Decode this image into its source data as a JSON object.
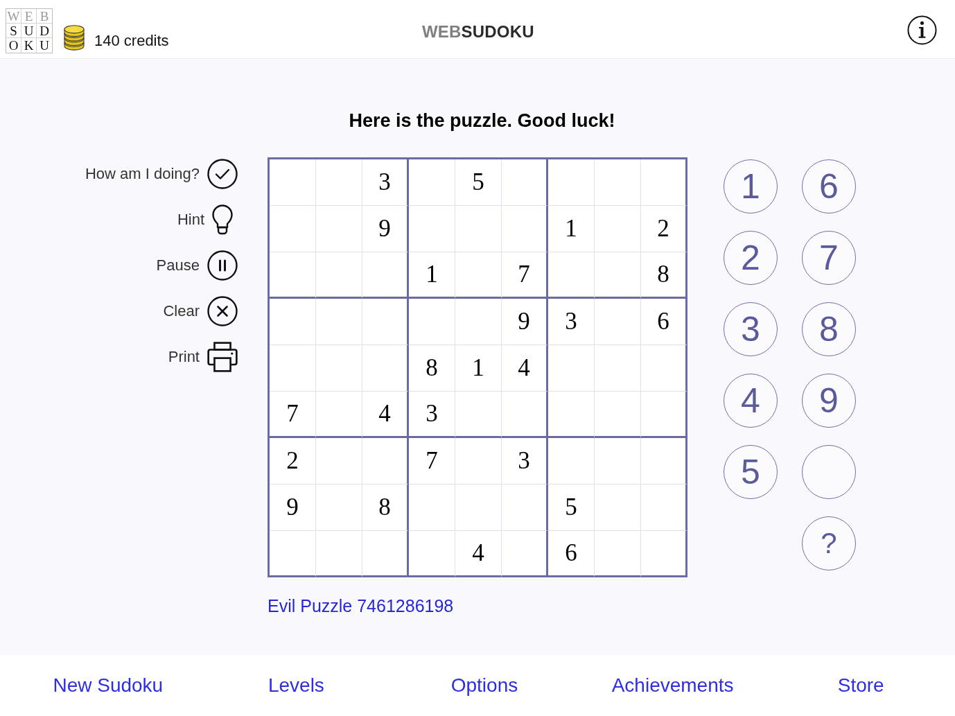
{
  "header": {
    "logo_rows": [
      {
        "letters": [
          "W",
          "E",
          "B"
        ],
        "color": "#9a9a9a"
      },
      {
        "letters": [
          "S",
          "U",
          "D"
        ],
        "color": "#111111"
      },
      {
        "letters": [
          "O",
          "K",
          "U"
        ],
        "color": "#111111"
      }
    ],
    "credits": "140 credits",
    "title_parts": [
      {
        "text": "WEB",
        "color": "#7f7f7f"
      },
      {
        "text": "SUDOKU",
        "color": "#2b2b2b"
      }
    ]
  },
  "heading": "Here is the puzzle. Good luck!",
  "actions": [
    {
      "label": "How am I doing?",
      "kind": "check"
    },
    {
      "label": "Hint",
      "kind": "hint"
    },
    {
      "label": "Pause",
      "kind": "pause"
    },
    {
      "label": "Clear",
      "kind": "clear"
    },
    {
      "label": "Print",
      "kind": "print"
    }
  ],
  "grid": {
    "rows": [
      [
        null,
        null,
        "3",
        null,
        "5",
        null,
        null,
        null,
        null
      ],
      [
        null,
        null,
        "9",
        null,
        null,
        null,
        "1",
        null,
        "2"
      ],
      [
        null,
        null,
        null,
        "1",
        null,
        "7",
        null,
        null,
        "8"
      ],
      [
        null,
        null,
        null,
        null,
        null,
        "9",
        "3",
        null,
        "6"
      ],
      [
        null,
        null,
        null,
        "8",
        "1",
        "4",
        null,
        null,
        null
      ],
      [
        "7",
        null,
        "4",
        "3",
        null,
        null,
        null,
        null,
        null
      ],
      [
        "2",
        null,
        null,
        "7",
        null,
        "3",
        null,
        null,
        null
      ],
      [
        "9",
        null,
        "8",
        null,
        null,
        null,
        "5",
        null,
        null
      ],
      [
        null,
        null,
        null,
        null,
        "4",
        null,
        "6",
        null,
        null
      ]
    ]
  },
  "puzzle_link": "Evil Puzzle 7461286198",
  "keypad": {
    "columns": [
      [
        {
          "kind": "digit",
          "label": "1"
        },
        {
          "kind": "digit",
          "label": "2"
        },
        {
          "kind": "digit",
          "label": "3"
        },
        {
          "kind": "digit",
          "label": "4"
        },
        {
          "kind": "digit",
          "label": "5"
        }
      ],
      [
        {
          "kind": "digit",
          "label": "6"
        },
        {
          "kind": "digit",
          "label": "7"
        },
        {
          "kind": "digit",
          "label": "8"
        },
        {
          "kind": "digit",
          "label": "9"
        },
        {
          "kind": "blank"
        },
        {
          "kind": "help",
          "label": "?"
        }
      ]
    ]
  },
  "bottom_tabs": [
    {
      "label": "New Sudoku"
    },
    {
      "label": "Levels"
    },
    {
      "label": "Options"
    },
    {
      "label": "Achievements"
    },
    {
      "label": "Store"
    }
  ]
}
